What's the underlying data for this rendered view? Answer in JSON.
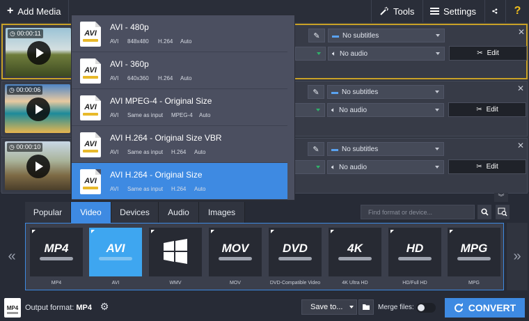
{
  "topbar": {
    "add_media": "Add Media",
    "tools": "Tools",
    "settings": "Settings"
  },
  "files": [
    {
      "time": "00:00:11",
      "subtitles": "No subtitles",
      "audio": "No audio",
      "edit": "Edit"
    },
    {
      "time": "00:00:06",
      "subtitles": "No subtitles",
      "audio": "No audio",
      "edit": "Edit"
    },
    {
      "time": "00:00:10",
      "subtitles": "No subtitles",
      "audio": "No audio",
      "edit": "Edit"
    }
  ],
  "presets": [
    {
      "icon": "AVI",
      "name": "AVI - 480p",
      "codec": "AVI",
      "size": "848x480",
      "video": "H.264",
      "audio": "Auto"
    },
    {
      "icon": "AVI",
      "name": "AVI - 360p",
      "codec": "AVI",
      "size": "640x360",
      "video": "H.264",
      "audio": "Auto"
    },
    {
      "icon": "AVI",
      "name": "AVI MPEG-4 - Original Size",
      "codec": "AVI",
      "size": "Same as input",
      "video": "MPEG-4",
      "audio": "Auto"
    },
    {
      "icon": "AVI",
      "name": "AVI H.264 - Original Size VBR",
      "codec": "AVI",
      "size": "Same as input",
      "video": "H.264",
      "audio": "Auto"
    },
    {
      "icon": "AVI",
      "name": "AVI H.264 - Original Size",
      "codec": "AVI",
      "size": "Same as input",
      "video": "H.264",
      "audio": "Auto"
    }
  ],
  "tabs": [
    "Popular",
    "Video",
    "Devices",
    "Audio",
    "Images"
  ],
  "search_placeholder": "Find format or device...",
  "formats": [
    {
      "big": "MP4",
      "cap": "MP4"
    },
    {
      "big": "AVI",
      "cap": "AVI"
    },
    {
      "big": "",
      "cap": "WMV"
    },
    {
      "big": "MOV",
      "cap": "MOV"
    },
    {
      "big": "DVD",
      "cap": "DVD-Compatible Video"
    },
    {
      "big": "4K",
      "cap": "4K Ultra HD"
    },
    {
      "big": "HD",
      "cap": "HD/Full HD"
    },
    {
      "big": "MPG",
      "cap": "MPG"
    }
  ],
  "footer": {
    "output_label": "Output format:",
    "output_value": "MP4",
    "save_to": "Save to...",
    "merge": "Merge files:",
    "convert": "CONVERT",
    "file_icon_text": "MP4"
  },
  "colors": {
    "accent": "#3e8ae2",
    "selected_border": "#c9a227"
  }
}
